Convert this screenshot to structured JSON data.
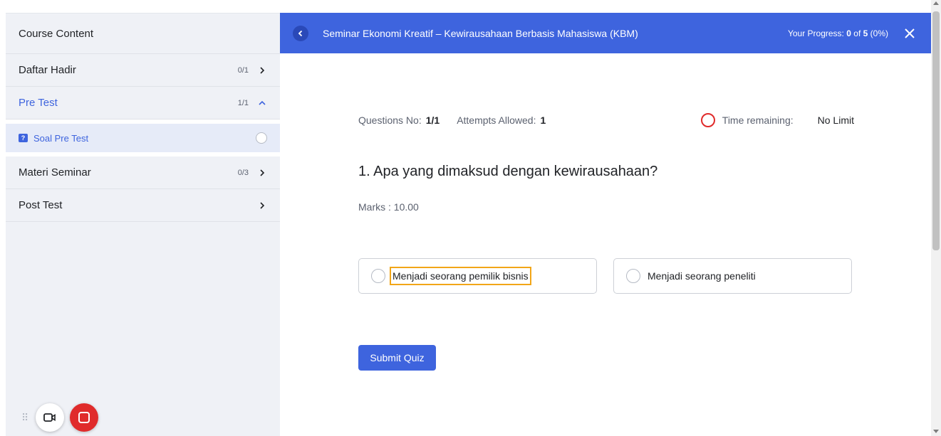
{
  "sidebar": {
    "header": "Course Content",
    "items": [
      {
        "label": "Daftar Hadir",
        "count": "0/1",
        "chevron": "chevron-right-icon"
      },
      {
        "label": "Pre Test",
        "count": "1/1",
        "chevron": "chevron-up-icon"
      },
      {
        "label": "Materi Seminar",
        "count": "0/3",
        "chevron": "chevron-right-icon"
      },
      {
        "label": "Post Test",
        "count": "",
        "chevron": "chevron-right-icon"
      }
    ],
    "sub_item": {
      "label": "Soal Pre Test",
      "icon": "quiz-icon"
    }
  },
  "topbar": {
    "title": "Seminar Ekonomi Kreatif – Kewirausahaan Berbasis Mahasiswa (KBM)",
    "progress_label": "Your Progress:",
    "progress_current": "0",
    "progress_of": "of",
    "progress_total": "5",
    "progress_percent": "(0%)"
  },
  "quiz": {
    "questions_label": "Questions No:",
    "questions_value": "1/1",
    "attempts_label": "Attempts Allowed:",
    "attempts_value": "1",
    "time_label": "Time remaining:",
    "time_value": "No Limit",
    "question": "1. Apa yang dimaksud dengan kewirausahaan?",
    "marks": "Marks : 10.00",
    "answers": [
      "Menjadi seorang pemilik bisnis",
      "Menjadi seorang peneliti"
    ],
    "submit_label": "Submit Quiz"
  },
  "colors": {
    "accent": "#3e64de",
    "record": "#e02b2b",
    "focus": "#f2a618"
  }
}
